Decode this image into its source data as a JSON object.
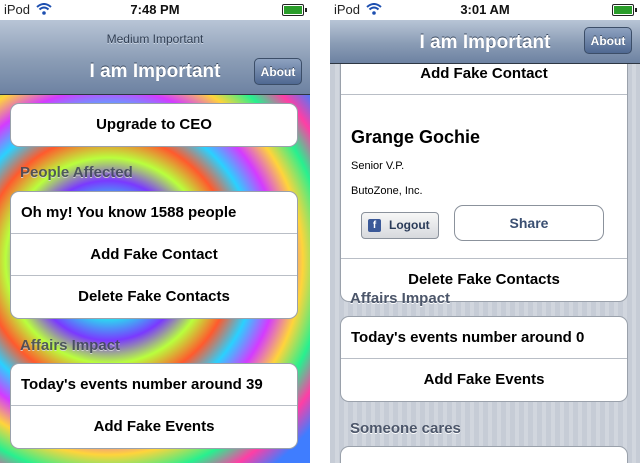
{
  "left": {
    "status": {
      "carrier": "iPod",
      "time": "7:48 PM"
    },
    "nav": {
      "prompt": "Medium Important",
      "title": "I am Important",
      "about": "About"
    },
    "upgrade": "Upgrade to CEO",
    "people_header": "People Affected",
    "people": {
      "count_text": "Oh my! You know 1588 people",
      "add": "Add Fake Contact",
      "delete": "Delete Fake Contacts"
    },
    "affairs_header": "Affairs Impact",
    "affairs": {
      "events_text": "Today's events number around 39",
      "add": "Add Fake Events"
    }
  },
  "right": {
    "status": {
      "carrier": "iPod",
      "time": "3:01 AM"
    },
    "nav": {
      "title": "I am Important",
      "about": "About"
    },
    "contact": {
      "add": "Add Fake Contact",
      "name": "Grange Gochie",
      "job_title": "Senior V.P.",
      "company": "ButoZone, Inc.",
      "logout": "Logout",
      "share": "Share",
      "delete": "Delete Fake Contacts"
    },
    "affairs_header": "Affairs Impact",
    "affairs": {
      "events_text": "Today's events number around 0",
      "add": "Add Fake Events"
    },
    "cares_header": "Someone cares"
  },
  "icons": {
    "wifi": "wifi-icon",
    "battery": "battery-icon",
    "facebook": "facebook-icon"
  },
  "colors": {
    "navbar": "#8a9cb5",
    "battery": "#2a9d2a",
    "facebook": "#3b5998",
    "section_header": "#4c566a"
  }
}
